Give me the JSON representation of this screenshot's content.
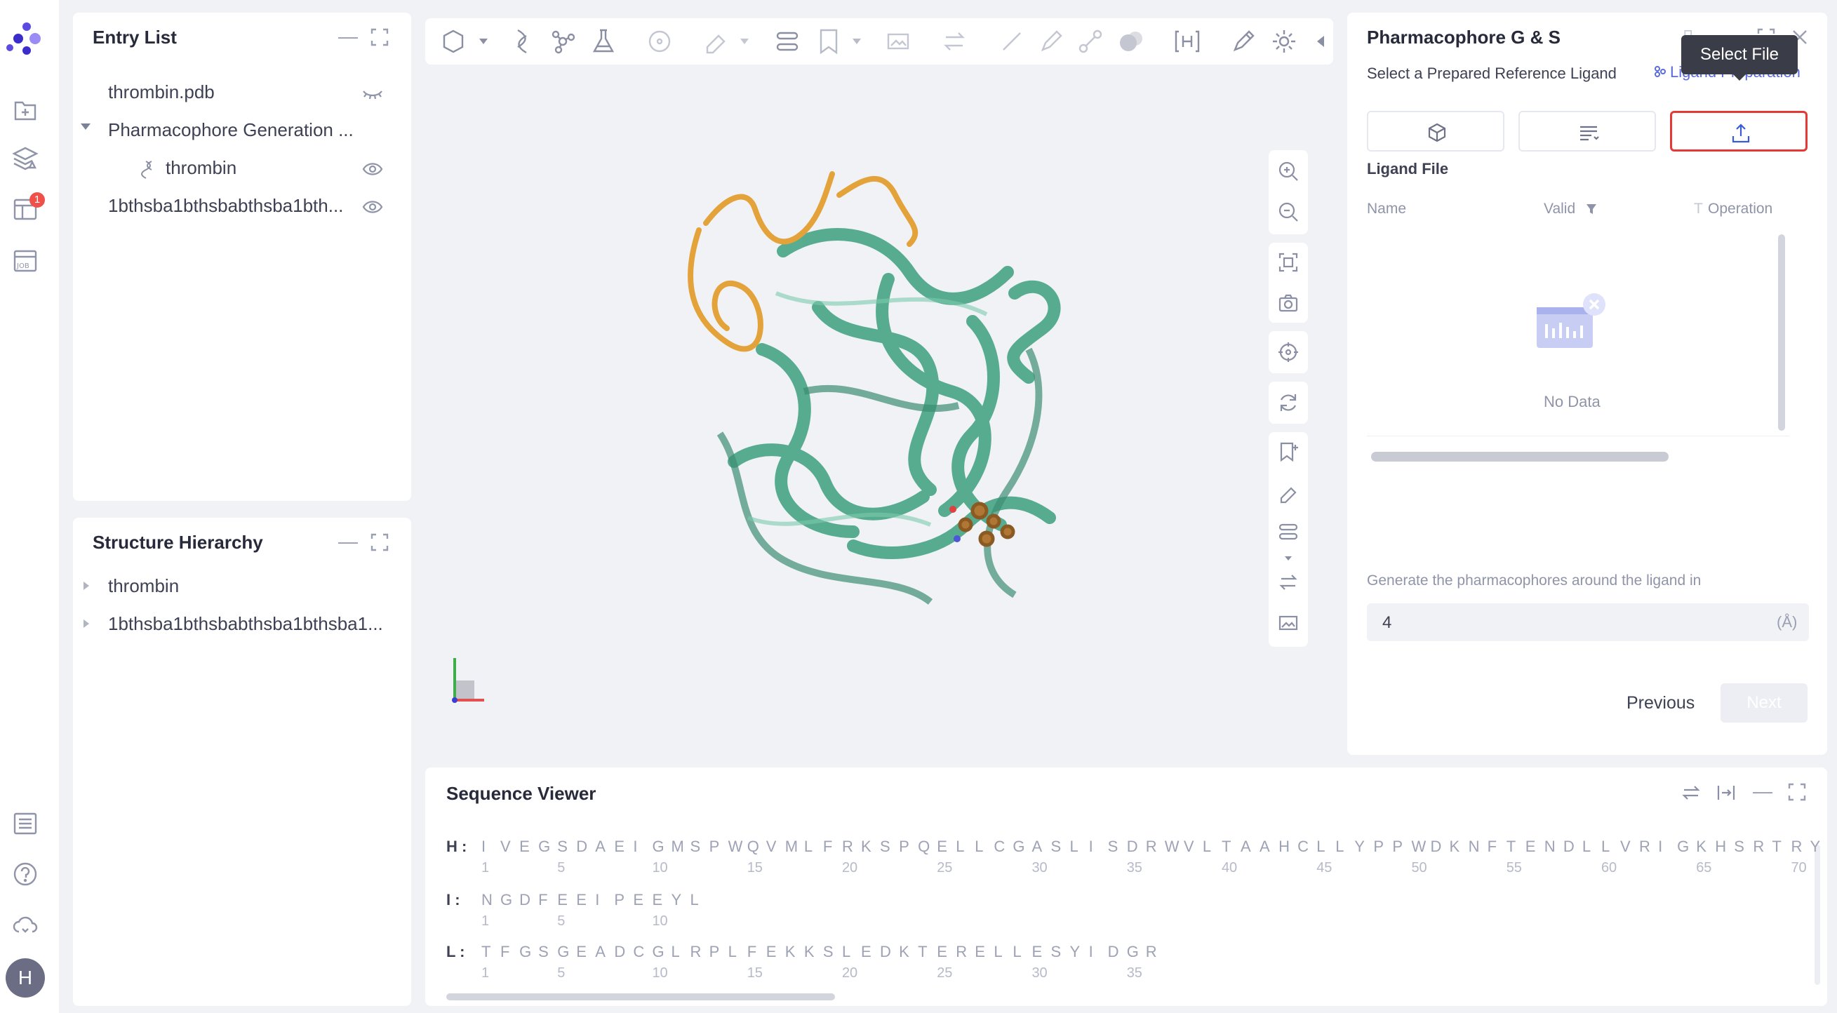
{
  "sidebar": {
    "notification_count": "1",
    "user_initial": "H",
    "icons": [
      "app-logo-icon",
      "new-project-icon",
      "layers-icon",
      "table-icon",
      "job-icon",
      "list-icon",
      "help-icon",
      "cloud-icon"
    ]
  },
  "entry_list": {
    "title": "Entry List",
    "items": [
      {
        "label": "thrombin.pdb",
        "eye": "eye-closed-icon"
      },
      {
        "label": "Pharmacophore Generation ...",
        "eye": ""
      },
      {
        "label": "thrombin",
        "eye": "eye-icon"
      },
      {
        "label": "1bthsba1bthsbabthsba1bth...",
        "eye": "eye-icon"
      }
    ]
  },
  "structure_hierarchy": {
    "title": "Structure Hierarchy",
    "items": [
      {
        "label": "thrombin"
      },
      {
        "label": "1bthsba1bthsbabthsba1bthsba1..."
      }
    ]
  },
  "pharmacophore_panel": {
    "title": "Pharmacophore G & S",
    "subtitle": "Select a Prepared Reference Ligand",
    "link": "Ligand Preparation",
    "tooltip": "Select File",
    "ligand_file_label": "Ligand File",
    "columns": [
      "Name",
      "Valid",
      "Operation"
    ],
    "empty_text": "No Data",
    "radius_label": "Generate the pharmacophores around the ligand in",
    "radius_value": "4",
    "radius_unit": "(Å)",
    "previous": "Previous",
    "next": "Next",
    "accent": "#e53935"
  },
  "sequence_viewer": {
    "title": "Sequence Viewer",
    "chains": [
      {
        "label": "H :",
        "residues": "IVEGSDAEIGMSPWQVMLFRKSPQELLCGASLISDRWVLTAAHCLLYPPWDKNFTENDLLVRIGKHSRTRY",
        "ticks": [
          "1",
          "5",
          "10",
          "15",
          "20",
          "25",
          "30",
          "35",
          "40",
          "45",
          "50",
          "55",
          "60",
          "65",
          "70"
        ]
      },
      {
        "label": "I :",
        "residues": "NGDFEEIPEEYL",
        "ticks": [
          "1",
          "5",
          "10"
        ]
      },
      {
        "label": "L :",
        "residues": "TFGSGEADCGLRPLFEKKSLEDKTERELLESYIDGR",
        "ticks": [
          "1",
          "5",
          "10",
          "15",
          "20",
          "25",
          "30",
          "35"
        ]
      }
    ]
  },
  "viewer": {
    "protein_color": "#4fa98a",
    "ligand_color": "#e3a33a"
  }
}
